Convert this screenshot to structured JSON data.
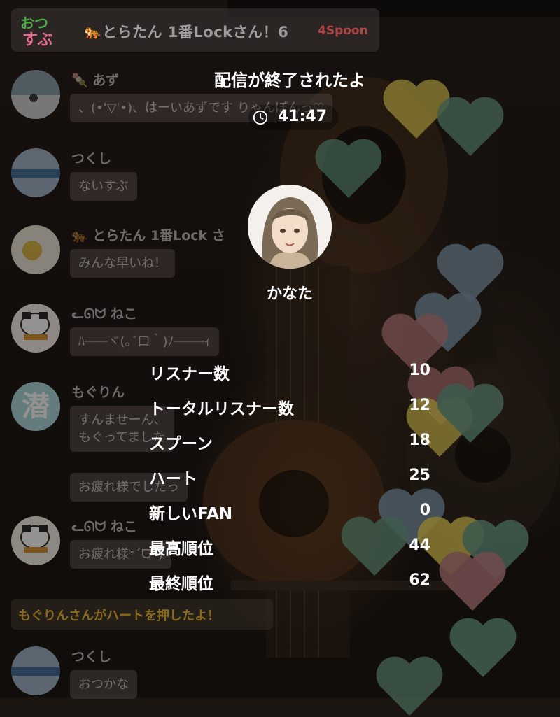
{
  "stream": {
    "title_icon": "tiger-emoji",
    "title": "とらたん 1番Lockさん！6",
    "spoon_count": "4Spoon",
    "logo_text_top": "おつ",
    "logo_text_bottom": "すぶ"
  },
  "chat": [
    {
      "name": "あず",
      "name_icon": "dango-emoji",
      "messages": [
        "、(•'▽'•)、はーいあずです"
      ]
    },
    {
      "name": "つくし",
      "messages": [
        "ないすぶ"
      ]
    },
    {
      "name": "とらたん 1番Lock さ",
      "name_icon": "tiger-emoji",
      "messages": [
        "みんな早いね！"
      ]
    },
    {
      "name": "ᓚᘏᗢ ねこ",
      "messages": [
        "ﾊ───ヾ(｡´口｀)ﾉ────ｨ"
      ]
    },
    {
      "name": "もぐりん",
      "avatar_text": "潜",
      "messages": [
        "すんませーん、\nもぐってました",
        "お疲れ様でしたっ"
      ]
    },
    {
      "name": "ᓚᘏᗢ ねこ",
      "messages": [
        "お疲れ様*ˊᗜˋ)"
      ]
    },
    {
      "name": "つくし",
      "messages": [
        "おつかな"
      ]
    }
  ],
  "notice": "もぐりんさんがハートを押したよ！",
  "overlay_snippet": "りゃんぽんっ♡",
  "summary": {
    "title": "配信が終了されたよ",
    "duration": "41:47",
    "host_name": "かなた",
    "stats": [
      {
        "label": "リスナー数",
        "value": "10"
      },
      {
        "label": "トータルリスナー数",
        "value": "12"
      },
      {
        "label": "スプーン",
        "value": "18"
      },
      {
        "label": "ハート",
        "value": "25"
      },
      {
        "label": "新しいFAN",
        "value": "0"
      },
      {
        "label": "最高順位",
        "value": "44"
      },
      {
        "label": "最終順位",
        "value": "62"
      }
    ]
  },
  "colors": {
    "spoon": "#e05050",
    "notice": "#e0a81e",
    "heart_gray": "#4a5862",
    "heart_green": "#3f5a4c",
    "heart_yellow": "#8c7d33",
    "heart_pink": "#6e4a4a"
  }
}
